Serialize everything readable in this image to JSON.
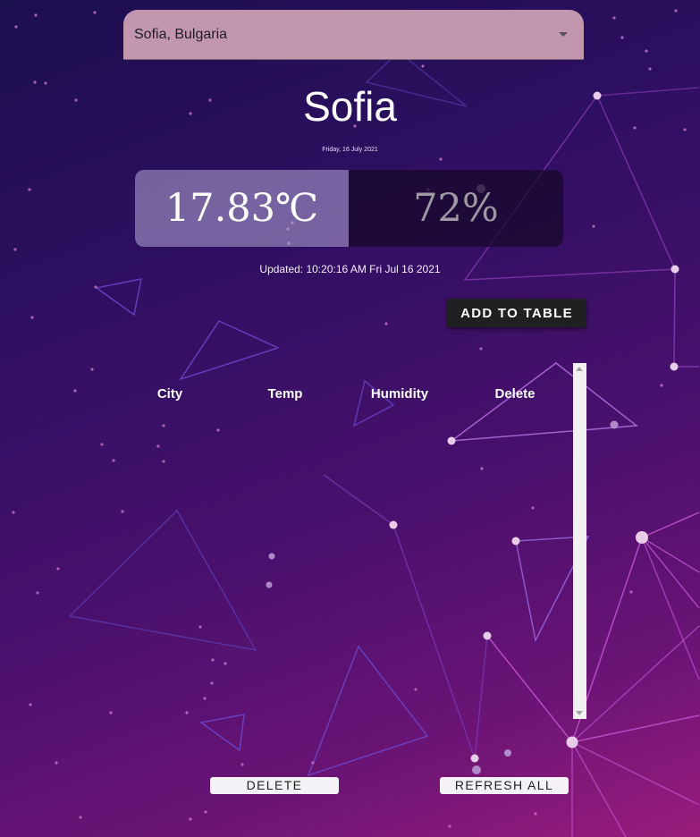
{
  "city_select": {
    "value": "Sofia, Bulgaria",
    "icon": "dropdown-caret-icon"
  },
  "weather": {
    "city": "Sofia",
    "date": "Friday, 16 July 2021",
    "temperature": "17.83℃",
    "humidity": "72%",
    "updated": "Updated: 10:20:16 AM Fri Jul 16 2021"
  },
  "actions": {
    "add_to_table": "ADD TO TABLE",
    "delete": "DELETE",
    "refresh_all": "REFRESH ALL"
  },
  "table": {
    "headers": [
      "City",
      "Temp",
      "Humidity",
      "Delete"
    ],
    "rows": []
  },
  "colors": {
    "select_bg": "#c396b0",
    "button_dark": "#202022",
    "button_light": "#f4f2f6",
    "background_start": "#1c0f4e",
    "background_end": "#9a1c7c"
  }
}
